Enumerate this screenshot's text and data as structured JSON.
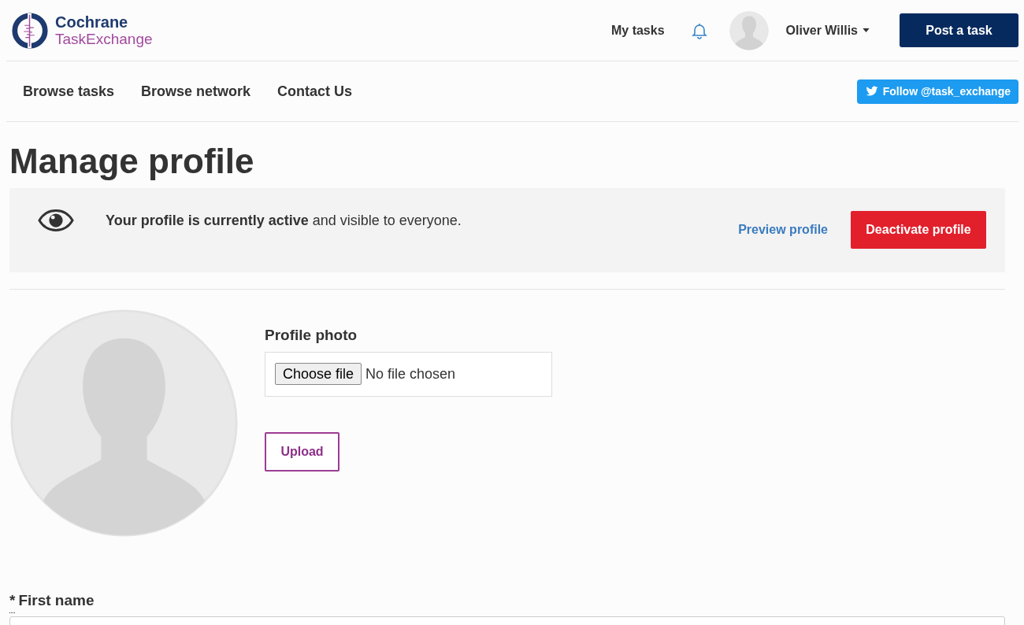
{
  "logo": {
    "line1": "Cochrane",
    "line2": "TaskExchange"
  },
  "header": {
    "my_tasks": "My tasks",
    "user_name": "Oliver Willis",
    "post_button": "Post a task"
  },
  "nav": {
    "items": [
      "Browse tasks",
      "Browse network",
      "Contact Us"
    ],
    "follow_button": "Follow @task_exchange"
  },
  "page_title": "Manage profile",
  "status_banner": {
    "message": "**Your profile is currently active** and visible to everyone.",
    "preview_link": "Preview profile",
    "deactivate_button": "Deactivate profile"
  },
  "photo": {
    "label": "Profile photo",
    "choose_button": "Choose file",
    "file_status": "No file chosen",
    "upload_button": "Upload"
  },
  "form": {
    "required_mark": "*",
    "first_name_label": "First name"
  }
}
